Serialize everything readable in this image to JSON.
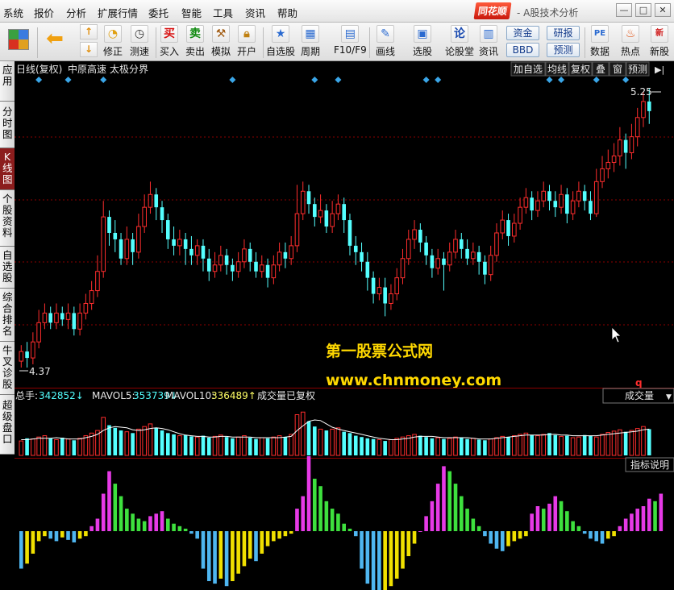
{
  "menu": [
    "系统",
    "报价",
    "分析",
    "扩展行情",
    "委托",
    "智能",
    "工具",
    "资讯",
    "帮助"
  ],
  "brand": {
    "logo": "同花顺",
    "title": "- A股技术分析"
  },
  "window_buttons": [
    "—",
    "□",
    "✕"
  ],
  "toolbar": {
    "up_down": [
      "↑",
      "↓"
    ],
    "items": [
      "修正",
      "测速",
      "买入",
      "卖出",
      "模拟",
      "开户",
      "自选股",
      "周期",
      "F10/F9",
      "画线",
      "选股",
      "论股堂",
      "资讯",
      "数据",
      "热点",
      "新股"
    ],
    "chips": [
      "资金",
      "研报",
      "BBD",
      "预测"
    ]
  },
  "sidebar": [
    "应用",
    "分时图",
    "K线图",
    "个股资料",
    "自选股",
    "综合排名",
    "牛叉诊股",
    "超级盘口"
  ],
  "chart_header": {
    "period": "日线(复权)",
    "stock": "中原高速",
    "indicator": "太极分界"
  },
  "chart_tabs": [
    "加自选",
    "均线",
    "复权",
    "叠",
    "窗",
    "预测",
    "▶|"
  ],
  "price": {
    "high_label": "5.25",
    "low_label": "4.37"
  },
  "watermark": {
    "line1": "第一股票公式网",
    "line2": "www.chnmoney.com"
  },
  "marker": "q",
  "volume": {
    "total_label": "总手:",
    "total_value": "342852↓",
    "mavol5_label": "MAVOL5:",
    "mavol5_value": "353739↓",
    "mavol10_label": "MAVOL10:",
    "mavol10_value": "336489↑",
    "note": "成交量已复权",
    "selector": "成交量",
    "explain": "指标说明"
  },
  "colors": {
    "up": "#ff2d2d",
    "down": "#54ffff",
    "grid": "#8b0000",
    "ma5": "#ffffff",
    "ma10": "#ffff00",
    "osc_magenta": "#e63ae6",
    "osc_green": "#3ee03e",
    "osc_yellow": "#f0e000",
    "osc_blue": "#4fb6f0",
    "diamond": "#3aa6e8",
    "watermark": "#ffd800"
  },
  "chart_data": {
    "type": "candlestick",
    "title": "中原高速",
    "ylim": [
      4.37,
      5.25
    ],
    "candles": [
      [
        4.4,
        4.43,
        4.38,
        4.45
      ],
      [
        4.43,
        4.41,
        4.38,
        4.46
      ],
      [
        4.41,
        4.46,
        4.39,
        4.49
      ],
      [
        4.46,
        4.52,
        4.44,
        4.56
      ],
      [
        4.52,
        4.55,
        4.5,
        4.58
      ],
      [
        4.55,
        4.52,
        4.5,
        4.57
      ],
      [
        4.52,
        4.55,
        4.5,
        4.58
      ],
      [
        4.55,
        4.53,
        4.51,
        4.57
      ],
      [
        4.53,
        4.55,
        4.5,
        4.58
      ],
      [
        4.55,
        4.5,
        4.48,
        4.57
      ],
      [
        4.5,
        4.55,
        4.48,
        4.58
      ],
      [
        4.55,
        4.58,
        4.53,
        4.61
      ],
      [
        4.58,
        4.62,
        4.56,
        4.65
      ],
      [
        4.62,
        4.68,
        4.6,
        4.73
      ],
      [
        4.68,
        4.85,
        4.66,
        4.9
      ],
      [
        4.85,
        4.8,
        4.76,
        4.87
      ],
      [
        4.8,
        4.78,
        4.74,
        4.84
      ],
      [
        4.78,
        4.72,
        4.7,
        4.8
      ],
      [
        4.72,
        4.78,
        4.7,
        4.82
      ],
      [
        4.78,
        4.74,
        4.7,
        4.8
      ],
      [
        4.74,
        4.82,
        4.72,
        4.86
      ],
      [
        4.82,
        4.88,
        4.8,
        4.92
      ],
      [
        4.88,
        4.92,
        4.86,
        4.96
      ],
      [
        4.92,
        4.88,
        4.84,
        4.94
      ],
      [
        4.88,
        4.84,
        4.8,
        4.9
      ],
      [
        4.84,
        4.78,
        4.75,
        4.86
      ],
      [
        4.78,
        4.76,
        4.73,
        4.82
      ],
      [
        4.76,
        4.78,
        4.73,
        4.81
      ],
      [
        4.78,
        4.75,
        4.7,
        4.8
      ],
      [
        4.75,
        4.73,
        4.7,
        4.79
      ],
      [
        4.73,
        4.76,
        4.7,
        4.78
      ],
      [
        4.76,
        4.72,
        4.68,
        4.78
      ],
      [
        4.72,
        4.68,
        4.65,
        4.75
      ],
      [
        4.68,
        4.7,
        4.66,
        4.74
      ],
      [
        4.7,
        4.73,
        4.68,
        4.76
      ],
      [
        4.73,
        4.7,
        4.67,
        4.75
      ],
      [
        4.7,
        4.68,
        4.65,
        4.72
      ],
      [
        4.68,
        4.71,
        4.66,
        4.74
      ],
      [
        4.71,
        4.75,
        4.69,
        4.78
      ],
      [
        4.75,
        4.71,
        4.68,
        4.77
      ],
      [
        4.71,
        4.68,
        4.66,
        4.74
      ],
      [
        4.68,
        4.7,
        4.66,
        4.73
      ],
      [
        4.7,
        4.66,
        4.63,
        4.72
      ],
      [
        4.66,
        4.7,
        4.64,
        4.73
      ],
      [
        4.7,
        4.74,
        4.68,
        4.77
      ],
      [
        4.74,
        4.72,
        4.69,
        4.77
      ],
      [
        4.72,
        4.76,
        4.7,
        4.79
      ],
      [
        4.76,
        4.86,
        4.74,
        4.95
      ],
      [
        4.86,
        4.93,
        4.84,
        4.96
      ],
      [
        4.93,
        4.89,
        4.86,
        4.95
      ],
      [
        4.89,
        4.85,
        4.82,
        4.91
      ],
      [
        4.85,
        4.87,
        4.83,
        4.92
      ],
      [
        4.87,
        4.82,
        4.8,
        4.89
      ],
      [
        4.82,
        4.86,
        4.8,
        4.9
      ],
      [
        4.86,
        4.89,
        4.84,
        4.92
      ],
      [
        4.89,
        4.84,
        4.8,
        4.91
      ],
      [
        4.84,
        4.76,
        4.73,
        4.86
      ],
      [
        4.76,
        4.74,
        4.7,
        4.79
      ],
      [
        4.74,
        4.71,
        4.68,
        4.77
      ],
      [
        4.71,
        4.66,
        4.62,
        4.74
      ],
      [
        4.66,
        4.61,
        4.58,
        4.68
      ],
      [
        4.61,
        4.63,
        4.59,
        4.66
      ],
      [
        4.63,
        4.58,
        4.54,
        4.66
      ],
      [
        4.58,
        4.61,
        4.56,
        4.64
      ],
      [
        4.61,
        4.66,
        4.59,
        4.69
      ],
      [
        4.66,
        4.72,
        4.64,
        4.75
      ],
      [
        4.72,
        4.78,
        4.7,
        4.81
      ],
      [
        4.78,
        4.81,
        4.75,
        4.84
      ],
      [
        4.81,
        4.77,
        4.74,
        4.83
      ],
      [
        4.77,
        4.73,
        4.7,
        4.79
      ],
      [
        4.73,
        4.69,
        4.66,
        4.75
      ],
      [
        4.69,
        4.72,
        4.67,
        4.75
      ],
      [
        4.72,
        4.7,
        4.62,
        4.74
      ],
      [
        4.7,
        4.74,
        4.68,
        4.77
      ],
      [
        4.74,
        4.78,
        4.72,
        4.81
      ],
      [
        4.78,
        4.75,
        4.72,
        4.8
      ],
      [
        4.75,
        4.72,
        4.7,
        4.78
      ],
      [
        4.72,
        4.74,
        4.7,
        4.77
      ],
      [
        4.74,
        4.71,
        4.67,
        4.76
      ],
      [
        4.71,
        4.67,
        4.64,
        4.73
      ],
      [
        4.67,
        4.73,
        4.65,
        4.76
      ],
      [
        4.73,
        4.8,
        4.71,
        4.83
      ],
      [
        4.8,
        4.84,
        4.78,
        4.87
      ],
      [
        4.84,
        4.79,
        4.76,
        4.86
      ],
      [
        4.79,
        4.83,
        4.77,
        4.86
      ],
      [
        4.83,
        4.88,
        4.81,
        4.91
      ],
      [
        4.88,
        4.91,
        4.86,
        4.94
      ],
      [
        4.91,
        4.87,
        4.84,
        4.93
      ],
      [
        4.87,
        4.9,
        4.85,
        4.93
      ],
      [
        4.9,
        4.93,
        4.88,
        4.96
      ],
      [
        4.93,
        4.9,
        4.87,
        4.95
      ],
      [
        4.9,
        4.88,
        4.85,
        4.93
      ],
      [
        4.88,
        4.92,
        4.86,
        4.95
      ],
      [
        4.92,
        4.86,
        4.83,
        4.94
      ],
      [
        4.86,
        4.9,
        4.84,
        4.93
      ],
      [
        4.9,
        4.93,
        4.88,
        4.96
      ],
      [
        4.93,
        4.9,
        4.87,
        4.95
      ],
      [
        4.9,
        4.86,
        4.84,
        4.93
      ],
      [
        4.86,
        4.96,
        4.85,
        5.0
      ],
      [
        4.96,
        5.0,
        4.94,
        5.04
      ],
      [
        5.0,
        5.02,
        4.97,
        5.06
      ],
      [
        5.02,
        5.04,
        4.99,
        5.08
      ],
      [
        5.04,
        5.09,
        5.01,
        5.13
      ],
      [
        5.09,
        5.05,
        5.0,
        5.11
      ],
      [
        5.05,
        5.1,
        5.03,
        5.14
      ],
      [
        5.1,
        5.16,
        5.07,
        5.19
      ],
      [
        5.16,
        5.21,
        5.13,
        5.24
      ],
      [
        5.21,
        5.18,
        5.14,
        5.25
      ]
    ],
    "volume": [
      22,
      26,
      25,
      28,
      30,
      26,
      24,
      27,
      25,
      23,
      26,
      30,
      34,
      38,
      58,
      46,
      42,
      38,
      36,
      34,
      40,
      44,
      48,
      42,
      38,
      34,
      32,
      30,
      31,
      29,
      28,
      30,
      27,
      29,
      31,
      28,
      26,
      28,
      30,
      27,
      25,
      27,
      26,
      28,
      30,
      28,
      32,
      62,
      66,
      52,
      44,
      40,
      38,
      40,
      42,
      36,
      34,
      30,
      28,
      26,
      25,
      24,
      22,
      24,
      26,
      28,
      30,
      32,
      30,
      28,
      26,
      27,
      25,
      26,
      28,
      27,
      25,
      26,
      24,
      23,
      25,
      27,
      29,
      28,
      30,
      32,
      34,
      31,
      30,
      32,
      34,
      31,
      29,
      30,
      27,
      28,
      31,
      30,
      28,
      32,
      35,
      37,
      39,
      36,
      38,
      41,
      44,
      40
    ],
    "ma5": [
      24,
      24,
      25,
      26,
      26,
      26,
      27,
      26,
      25,
      25,
      25,
      27,
      29,
      32,
      38,
      42,
      44,
      43,
      42,
      39,
      38,
      39,
      41,
      42,
      41,
      39,
      36,
      33,
      31,
      30,
      29,
      29,
      28,
      28,
      29,
      29,
      28,
      28,
      28,
      28,
      27,
      27,
      27,
      27,
      27,
      28,
      29,
      38,
      45,
      52,
      54,
      53,
      48,
      43,
      40,
      38,
      36,
      34,
      32,
      30,
      28,
      26,
      25,
      24,
      24,
      25,
      26,
      28,
      29,
      29,
      29,
      28,
      27,
      27,
      27,
      27,
      27,
      26,
      25,
      25,
      25,
      26,
      27,
      28,
      29,
      30,
      31,
      31,
      31,
      31,
      32,
      32,
      31,
      31,
      30,
      30,
      30,
      30,
      30,
      31,
      32,
      33,
      34,
      35,
      36,
      37,
      39,
      40
    ],
    "oscillator": [
      -30,
      -26,
      -18,
      -8,
      -4,
      -6,
      -8,
      -5,
      -7,
      -9,
      -6,
      -4,
      4,
      10,
      30,
      48,
      38,
      28,
      18,
      14,
      10,
      8,
      12,
      14,
      16,
      10,
      6,
      4,
      2,
      -2,
      -6,
      -30,
      -40,
      -42,
      -38,
      -44,
      -40,
      -34,
      -28,
      -22,
      -24,
      -18,
      -12,
      -8,
      -6,
      -4,
      -2,
      18,
      28,
      60,
      42,
      36,
      24,
      18,
      14,
      6,
      2,
      -4,
      -30,
      -42,
      -50,
      -52,
      -48,
      -44,
      -38,
      -30,
      -20,
      -10,
      0,
      12,
      24,
      38,
      52,
      48,
      38,
      28,
      18,
      10,
      4,
      -4,
      -10,
      -14,
      -16,
      -12,
      -8,
      -6,
      -4,
      14,
      20,
      18,
      22,
      28,
      24,
      16,
      8,
      4,
      -2,
      -6,
      -8,
      -10,
      -6,
      -4,
      4,
      10,
      14,
      18,
      20,
      26,
      24,
      30
    ],
    "markers": [
      3,
      8,
      14,
      36,
      50,
      54,
      69,
      71,
      90,
      92,
      98,
      103
    ]
  }
}
